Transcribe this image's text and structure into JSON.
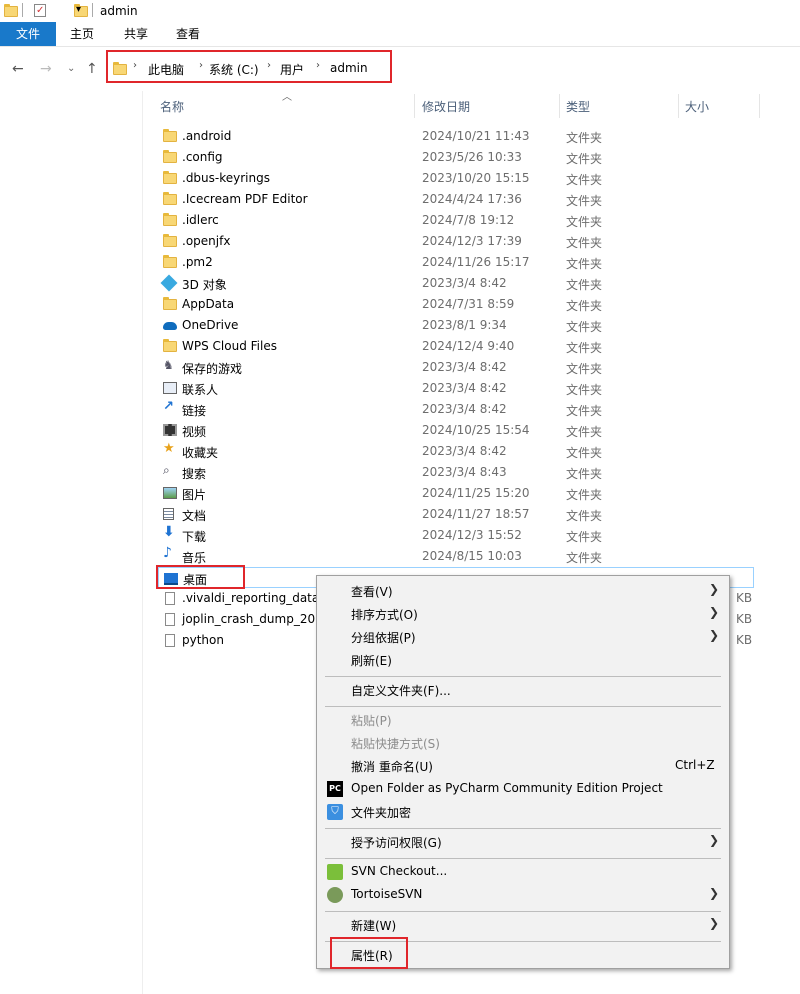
{
  "window": {
    "title": "admin"
  },
  "ribbon": {
    "tabs": [
      "文件",
      "主页",
      "共享",
      "查看"
    ]
  },
  "address": {
    "crumbs": [
      "此电脑",
      "系统 (C:)",
      "用户",
      "admin"
    ]
  },
  "columns": {
    "name": "名称",
    "date": "修改日期",
    "type": "类型",
    "size": "大小"
  },
  "files": [
    {
      "name": ".android",
      "date": "2024/10/21 11:43",
      "type": "文件夹",
      "icon": "folder-icon"
    },
    {
      "name": ".config",
      "date": "2023/5/26 10:33",
      "type": "文件夹",
      "icon": "folder-icon"
    },
    {
      "name": ".dbus-keyrings",
      "date": "2023/10/20 15:15",
      "type": "文件夹",
      "icon": "folder-icon"
    },
    {
      "name": ".Icecream PDF Editor",
      "date": "2024/4/24 17:36",
      "type": "文件夹",
      "icon": "folder-icon"
    },
    {
      "name": ".idlerc",
      "date": "2024/7/8 19:12",
      "type": "文件夹",
      "icon": "folder-icon"
    },
    {
      "name": ".openjfx",
      "date": "2024/12/3 17:39",
      "type": "文件夹",
      "icon": "folder-icon"
    },
    {
      "name": ".pm2",
      "date": "2024/11/26 15:17",
      "type": "文件夹",
      "icon": "folder-icon"
    },
    {
      "name": "3D 对象",
      "date": "2023/3/4 8:42",
      "type": "文件夹",
      "icon": "3d-objects-icon"
    },
    {
      "name": "AppData",
      "date": "2024/7/31 8:59",
      "type": "文件夹",
      "icon": "folder-icon"
    },
    {
      "name": "OneDrive",
      "date": "2023/8/1 9:34",
      "type": "文件夹",
      "icon": "onedrive-icon"
    },
    {
      "name": "WPS Cloud Files",
      "date": "2024/12/4 9:40",
      "type": "文件夹",
      "icon": "folder-icon"
    },
    {
      "name": "保存的游戏",
      "date": "2023/3/4 8:42",
      "type": "文件夹",
      "icon": "saved-games-icon"
    },
    {
      "name": "联系人",
      "date": "2023/3/4 8:42",
      "type": "文件夹",
      "icon": "contacts-icon"
    },
    {
      "name": "链接",
      "date": "2023/3/4 8:42",
      "type": "文件夹",
      "icon": "links-icon"
    },
    {
      "name": "视频",
      "date": "2024/10/25 15:54",
      "type": "文件夹",
      "icon": "videos-icon"
    },
    {
      "name": "收藏夹",
      "date": "2023/3/4 8:42",
      "type": "文件夹",
      "icon": "favorites-icon"
    },
    {
      "name": "搜索",
      "date": "2023/3/4 8:43",
      "type": "文件夹",
      "icon": "search-icon"
    },
    {
      "name": "图片",
      "date": "2024/11/25 15:20",
      "type": "文件夹",
      "icon": "pictures-icon"
    },
    {
      "name": "文档",
      "date": "2024/11/27 18:57",
      "type": "文件夹",
      "icon": "documents-icon"
    },
    {
      "name": "下载",
      "date": "2024/12/3 15:52",
      "type": "文件夹",
      "icon": "downloads-icon"
    },
    {
      "name": "音乐",
      "date": "2024/8/15 10:03",
      "type": "文件夹",
      "icon": "music-icon"
    },
    {
      "name": "桌面",
      "date": "",
      "type": "",
      "icon": "desktop-icon"
    },
    {
      "name": ".vivaldi_reporting_data",
      "date": "",
      "type": "",
      "size": "KB",
      "icon": "file-icon"
    },
    {
      "name": "joplin_crash_dump_2024",
      "date": "",
      "type": "",
      "size": "KB",
      "icon": "file-icon"
    },
    {
      "name": "python",
      "date": "",
      "type": "",
      "size": "KB",
      "icon": "file-icon"
    }
  ],
  "context_menu": {
    "items": [
      {
        "label": "查看(V)",
        "submenu": true
      },
      {
        "label": "排序方式(O)",
        "submenu": true
      },
      {
        "label": "分组依据(P)",
        "submenu": true
      },
      {
        "label": "刷新(E)"
      },
      {
        "sep": true
      },
      {
        "label": "自定义文件夹(F)..."
      },
      {
        "sep": true
      },
      {
        "label": "粘贴(P)",
        "disabled": true
      },
      {
        "label": "粘贴快捷方式(S)",
        "disabled": true
      },
      {
        "label": "撤消 重命名(U)",
        "shortcut": "Ctrl+Z"
      },
      {
        "label": "Open Folder as PyCharm Community Edition Project",
        "icon": "pycharm-icon"
      },
      {
        "label": "文件夹加密",
        "icon": "shield-icon"
      },
      {
        "sep": true
      },
      {
        "label": "授予访问权限(G)",
        "submenu": true
      },
      {
        "sep": true
      },
      {
        "label": "SVN Checkout...",
        "icon": "svn-checkout-icon"
      },
      {
        "label": "TortoiseSVN",
        "submenu": true,
        "icon": "tortoisesvn-icon"
      },
      {
        "sep": true
      },
      {
        "label": "新建(W)",
        "submenu": true
      },
      {
        "sep": true
      },
      {
        "label": "属性(R)"
      }
    ]
  }
}
